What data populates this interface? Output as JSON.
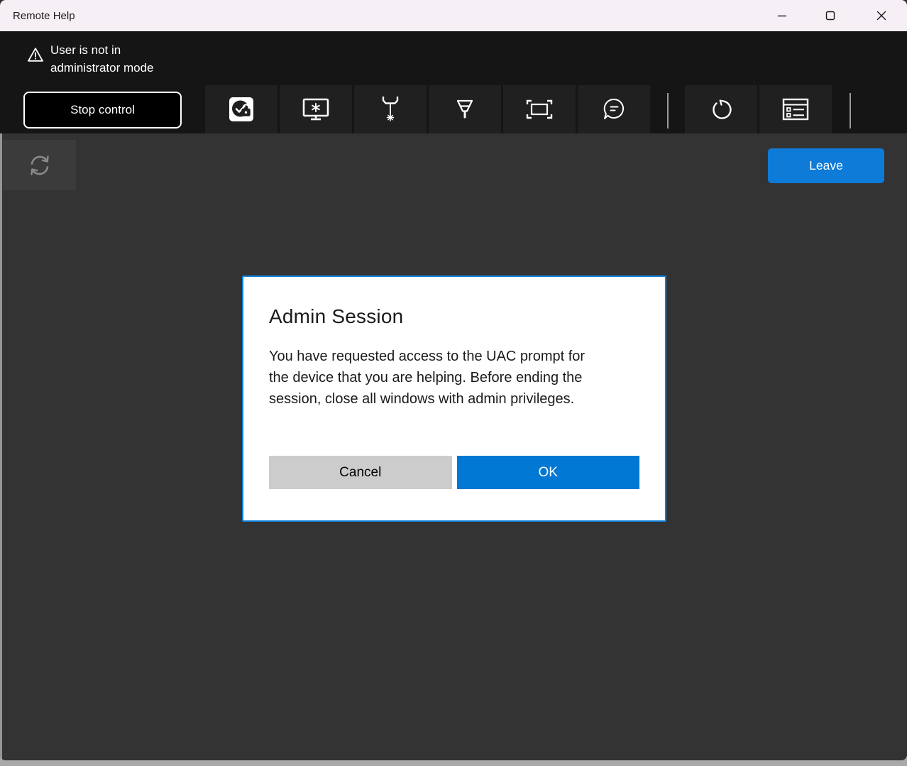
{
  "titlebar": {
    "title": "Remote Help"
  },
  "banner": {
    "warning": {
      "line1": "User is not in",
      "line2": "administrator mode"
    },
    "stop_control_label": "Stop control"
  },
  "toolbar": {
    "icons": [
      "uac-admin-icon",
      "monitor-asterisk-icon",
      "laser-pointer-icon",
      "pen-icon",
      "actual-size-icon",
      "chat-icon",
      "restart-icon",
      "session-details-icon"
    ]
  },
  "main": {
    "leave_label": "Leave",
    "sync_icon": "sync-icon"
  },
  "dialog": {
    "title": "Admin Session",
    "body": "You have requested access to the UAC prompt for the device that you are helping. Before ending the session, close all windows with admin privileges.",
    "cancel_label": "Cancel",
    "ok_label": "OK"
  },
  "colors": {
    "titlebar_bg": "#f6eff5",
    "banner_bg": "#151515",
    "tile_bg": "#202020",
    "main_bg": "#333333",
    "accent_blue": "#0078d4",
    "leave_blue": "#0d7bd7",
    "cancel_gray": "#cccccc",
    "dialog_border": "#1080d8"
  }
}
